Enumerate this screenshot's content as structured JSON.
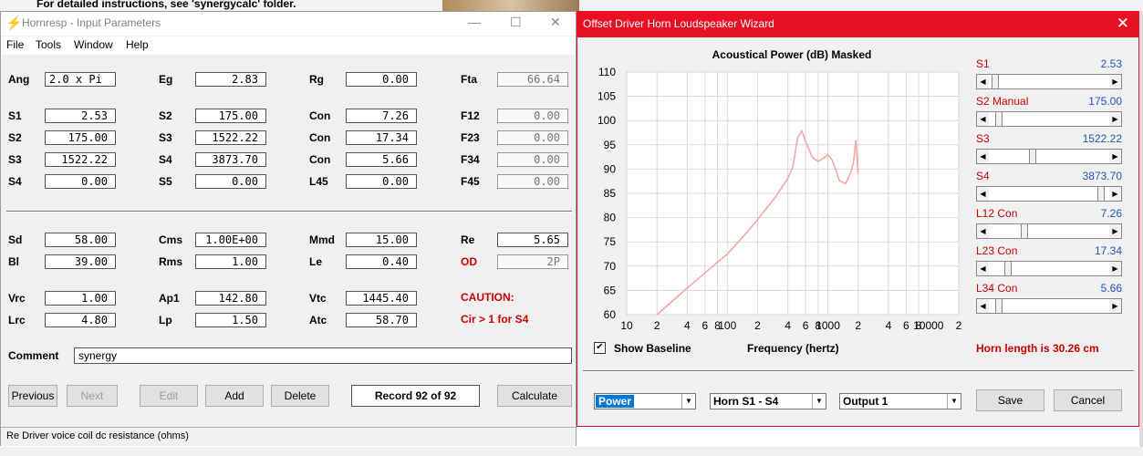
{
  "background": {
    "top_text": "For detailed instructions, see 'synergycalc' folder."
  },
  "hornresp": {
    "title": "Hornresp - Input Parameters",
    "menu": [
      "File",
      "Tools",
      "Window",
      "Help"
    ],
    "rows": [
      [
        {
          "label": "Ang",
          "value": "2.0 x Pi",
          "align": "left"
        },
        {
          "label": "Eg",
          "value": "2.83"
        },
        {
          "label": "Rg",
          "value": "0.00"
        },
        {
          "label": "Fta",
          "value": "66.64",
          "ro": true
        }
      ],
      [
        {
          "label": "S1",
          "value": "2.53"
        },
        {
          "label": "S2",
          "value": "175.00"
        },
        {
          "label": "Con",
          "value": "7.26"
        },
        {
          "label": "F12",
          "value": "0.00",
          "ro": true
        }
      ],
      [
        {
          "label": "S2",
          "value": "175.00"
        },
        {
          "label": "S3",
          "value": "1522.22"
        },
        {
          "label": "Con",
          "value": "17.34"
        },
        {
          "label": "F23",
          "value": "0.00",
          "ro": true
        }
      ],
      [
        {
          "label": "S3",
          "value": "1522.22"
        },
        {
          "label": "S4",
          "value": "3873.70"
        },
        {
          "label": "Con",
          "value": "5.66"
        },
        {
          "label": "F34",
          "value": "0.00",
          "ro": true
        }
      ],
      [
        {
          "label": "S4",
          "value": "0.00"
        },
        {
          "label": "S5",
          "value": "0.00"
        },
        {
          "label": "L45",
          "value": "0.00"
        },
        {
          "label": "F45",
          "value": "0.00",
          "ro": true
        }
      ],
      [
        {
          "label": "Sd",
          "value": "58.00"
        },
        {
          "label": "Cms",
          "value": "1.00E+00"
        },
        {
          "label": "Mmd",
          "value": "15.00"
        },
        {
          "label": "Re",
          "value": "5.65"
        }
      ],
      [
        {
          "label": "Bl",
          "value": "39.00"
        },
        {
          "label": "Rms",
          "value": "1.00"
        },
        {
          "label": "Le",
          "value": "0.40"
        },
        {
          "label": "OD",
          "value": "2P",
          "ro": true,
          "red": true
        }
      ],
      [
        {
          "label": "Vrc",
          "value": "1.00"
        },
        {
          "label": "Ap1",
          "value": "142.80"
        },
        {
          "label": "Vtc",
          "value": "1445.40"
        }
      ],
      [
        {
          "label": "Lrc",
          "value": "4.80"
        },
        {
          "label": "Lp",
          "value": "1.50"
        },
        {
          "label": "Atc",
          "value": "58.70"
        }
      ]
    ],
    "caution_title": "CAUTION:",
    "caution_text": "Cir > 1 for S4",
    "comment_label": "Comment",
    "comment_value": "synergy",
    "buttons": {
      "previous": "Previous",
      "next": "Next",
      "edit": "Edit",
      "add": "Add",
      "delete": "Delete",
      "record": "Record 92 of 92",
      "calculate": "Calculate"
    },
    "status": "Re   Driver voice coil dc resistance  (ohms)"
  },
  "wizard": {
    "title": "Offset Driver Horn Loudspeaker Wizard",
    "show_baseline": "Show Baseline",
    "horn_length": "Horn length is 30.26 cm",
    "dropdowns": {
      "mode": "Power",
      "horn": "Horn S1 - S4",
      "output": "Output 1"
    },
    "buttons": {
      "save": "Save",
      "cancel": "Cancel"
    },
    "sliders": [
      {
        "name": "S1",
        "value": "2.53",
        "pos": 0.02
      },
      {
        "name": "S2 Manual",
        "value": "175.00",
        "pos": 0.05
      },
      {
        "name": "S3",
        "value": "1522.22",
        "pos": 0.35
      },
      {
        "name": "S4",
        "value": "3873.70",
        "pos": 0.97
      },
      {
        "name": "L12 Con",
        "value": "7.26",
        "pos": 0.28
      },
      {
        "name": "L23 Con",
        "value": "17.34",
        "pos": 0.13
      },
      {
        "name": "L34 Con",
        "value": "5.66",
        "pos": 0.05
      }
    ]
  },
  "chart_data": {
    "type": "line",
    "title": "Acoustical Power (dB)   Masked",
    "xlabel": "Frequency (hertz)",
    "ylabel": "",
    "xscale": "log",
    "xlim": [
      10,
      20000
    ],
    "ylim": [
      60,
      110
    ],
    "yticks": [
      60,
      65,
      70,
      75,
      80,
      85,
      90,
      95,
      100,
      105,
      110
    ],
    "xticks": [
      {
        "v": 10,
        "t": "10"
      },
      {
        "v": 20,
        "t": "2"
      },
      {
        "v": 40,
        "t": "4"
      },
      {
        "v": 60,
        "t": "6"
      },
      {
        "v": 80,
        "t": "8"
      },
      {
        "v": 100,
        "t": "100"
      },
      {
        "v": 200,
        "t": "2"
      },
      {
        "v": 400,
        "t": "4"
      },
      {
        "v": 600,
        "t": "6"
      },
      {
        "v": 800,
        "t": "8"
      },
      {
        "v": 1000,
        "t": "1000"
      },
      {
        "v": 2000,
        "t": "2"
      },
      {
        "v": 4000,
        "t": "4"
      },
      {
        "v": 6000,
        "t": "6"
      },
      {
        "v": 8000,
        "t": "8"
      },
      {
        "v": 10000,
        "t": "10000"
      },
      {
        "v": 20000,
        "t": "2"
      }
    ],
    "grid": true,
    "color": "#f4a6a6",
    "series": [
      {
        "x": [
          20,
          30,
          40,
          60,
          80,
          100,
          150,
          200,
          300,
          400,
          450,
          500,
          550,
          600,
          700,
          800,
          850,
          900,
          1000,
          1100,
          1200,
          1300,
          1500,
          1700,
          1800,
          1900,
          2000
        ],
        "y": [
          60,
          63.2,
          65.5,
          68.6,
          70.8,
          72.5,
          76.5,
          79.6,
          84.2,
          88.1,
          90.5,
          96.4,
          97.9,
          95.7,
          92.4,
          91.6,
          91.9,
          92.2,
          93.0,
          91.9,
          89.8,
          87.6,
          87.0,
          89.5,
          91.5,
          96.0,
          89.0
        ]
      }
    ]
  }
}
